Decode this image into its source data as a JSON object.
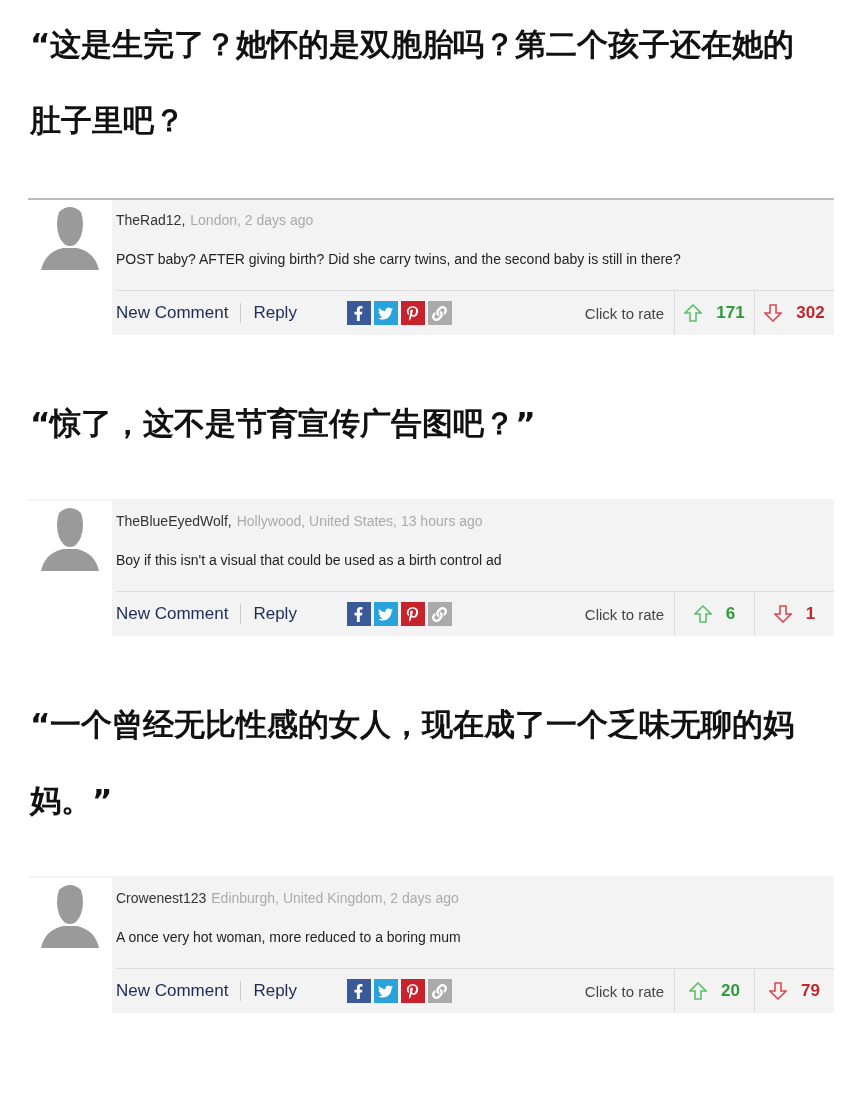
{
  "posts": [
    {
      "quote": "“这是生完了？她怀的是双胞胎吗？第二个孩子还在她的肚子里吧？",
      "comment": {
        "author": "TheRad12,",
        "meta": "London, 2 days ago",
        "body": "POST baby? AFTER giving birth? Did she carry twins, and the second baby is still in there?",
        "actions": [
          "New Comment",
          "Reply"
        ],
        "rate_label": "Click to rate",
        "up": "171",
        "down": "302",
        "top_rule": true
      }
    },
    {
      "quote": "“惊了，这不是节育宣传广告图吧？”",
      "comment": {
        "author": "TheBlueEyedWolf,",
        "meta": "Hollywood, United States, 13 hours ago",
        "body": "Boy if this isn't a visual that could be used as a birth control ad",
        "actions": [
          "New Comment",
          "Reply"
        ],
        "rate_label": "Click to rate",
        "up": "6",
        "down": "1",
        "top_rule": false
      }
    },
    {
      "quote": "“一个曾经无比性感的女人，现在成了一个乏味无聊的妈妈。”",
      "comment": {
        "author": "Crowenest123",
        "meta": "Edinburgh, United Kingdom, 2 days ago",
        "body": "A once very hot woman, more reduced to a boring mum",
        "actions": [
          "New Comment",
          "Reply"
        ],
        "rate_label": "Click to rate",
        "up": "20",
        "down": "79",
        "top_rule": false
      }
    }
  ]
}
